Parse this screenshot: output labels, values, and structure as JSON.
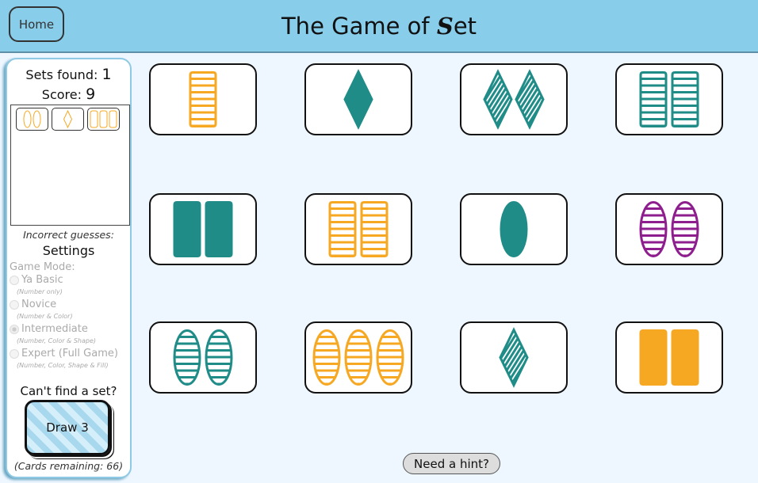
{
  "header": {
    "home_label": "Home",
    "title_prefix": "The Game of ",
    "title_logo": "S",
    "title_suffix": "et"
  },
  "sidebar": {
    "sets_found_label": "Sets found:",
    "sets_found": "1",
    "score_label": "Score:",
    "score": "9",
    "found_sets": [
      [
        {
          "count": 2,
          "color": "orange",
          "shape": "oval",
          "fill": "outline"
        },
        {
          "count": 1,
          "color": "orange",
          "shape": "diamond",
          "fill": "outline"
        },
        {
          "count": 3,
          "color": "orange",
          "shape": "rect",
          "fill": "outline"
        }
      ]
    ],
    "incorrect_label": "Incorrect guesses:",
    "settings_title": "Settings",
    "game_mode_label": "Game Mode:",
    "modes": [
      {
        "label": "Ya Basic",
        "desc": "(Number only)",
        "selected": false
      },
      {
        "label": "Novice",
        "desc": "(Number & Color)",
        "selected": false
      },
      {
        "label": "Intermediate",
        "desc": "(Number, Color & Shape)",
        "selected": true
      },
      {
        "label": "Expert (Full Game)",
        "desc": "(Number, Color, Shape & Fill)",
        "selected": false
      }
    ],
    "cant_find": "Can't find a set?",
    "draw_label": "Draw 3",
    "cards_remaining": "(Cards remaining: 66)"
  },
  "colors": {
    "orange": "#f7a823",
    "teal": "#1f8c88",
    "purple": "#8e1d8e",
    "header": "#88cdea"
  },
  "board": [
    {
      "count": 1,
      "color": "orange",
      "shape": "rect",
      "fill": "striped"
    },
    {
      "count": 1,
      "color": "teal",
      "shape": "diamond",
      "fill": "solid"
    },
    {
      "count": 2,
      "color": "teal",
      "shape": "diamond",
      "fill": "striped"
    },
    {
      "count": 2,
      "color": "teal",
      "shape": "rect",
      "fill": "striped"
    },
    {
      "count": 2,
      "color": "teal",
      "shape": "rect",
      "fill": "solid"
    },
    {
      "count": 2,
      "color": "orange",
      "shape": "rect",
      "fill": "striped"
    },
    {
      "count": 1,
      "color": "teal",
      "shape": "oval",
      "fill": "solid"
    },
    {
      "count": 2,
      "color": "purple",
      "shape": "oval",
      "fill": "striped"
    },
    {
      "count": 2,
      "color": "teal",
      "shape": "oval",
      "fill": "striped"
    },
    {
      "count": 3,
      "color": "orange",
      "shape": "oval",
      "fill": "striped"
    },
    {
      "count": 1,
      "color": "teal",
      "shape": "diamond",
      "fill": "striped"
    },
    {
      "count": 2,
      "color": "orange",
      "shape": "rect",
      "fill": "solid"
    }
  ],
  "hint_label": "Need a hint?"
}
